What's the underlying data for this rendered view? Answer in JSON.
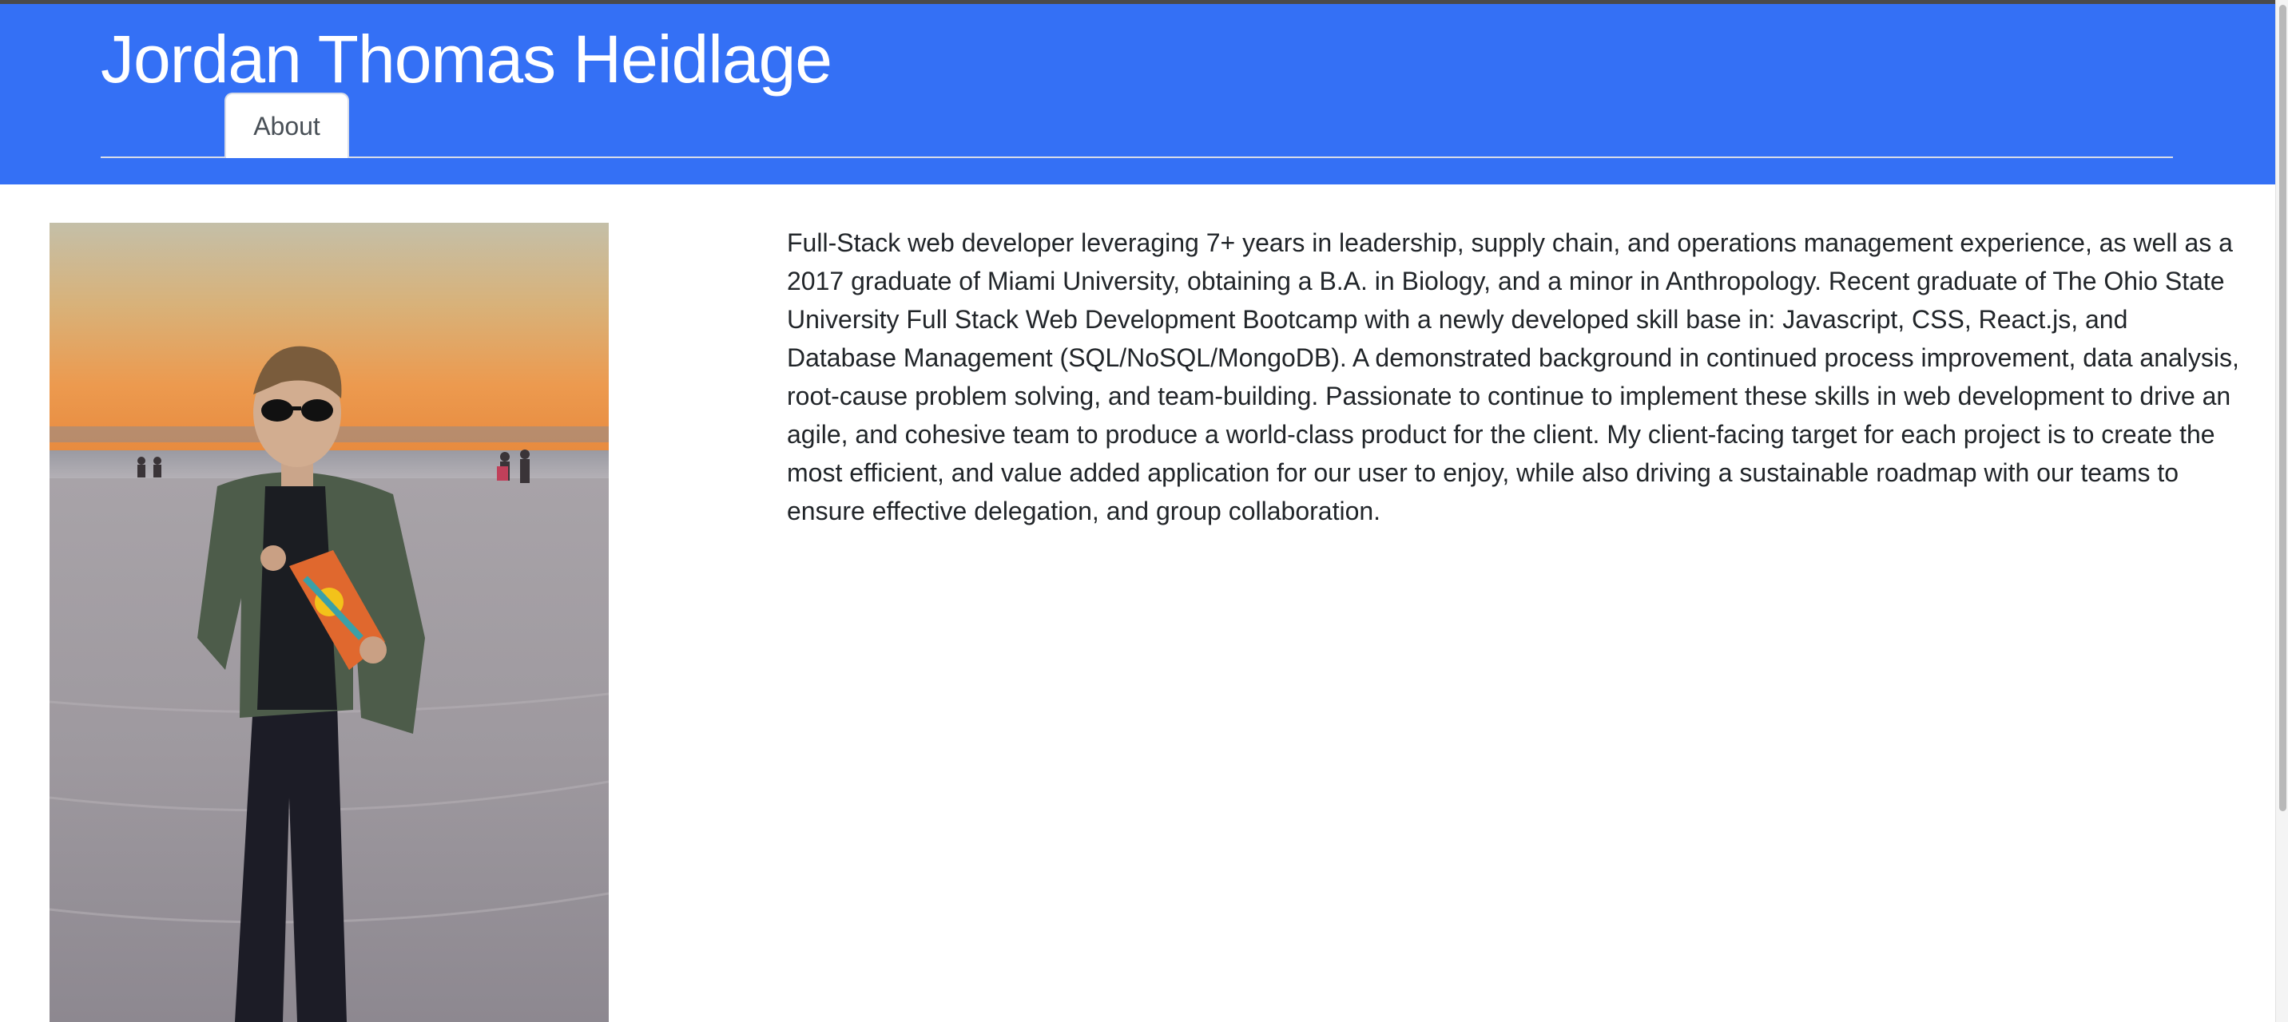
{
  "header": {
    "site_title": "Jordan Thomas Heidlage",
    "nav_tabs": [
      {
        "label": "About",
        "active": true
      }
    ]
  },
  "main": {
    "photo_alt": "Photo of Jordan Thomas Heidlage standing on a beach at sunset",
    "bio": "Full-Stack web developer leveraging 7+ years in leadership, supply chain, and operations management experience, as well as a 2017 graduate of Miami University, obtaining a B.A. in Biology, and a minor in Anthropology. Recent graduate of The Ohio State University Full Stack Web Development Bootcamp with a newly developed skill base in: Javascript, CSS, React.js, and Database Management (SQL/NoSQL/MongoDB). A demonstrated background in continued process improvement, data analysis, root-cause problem solving, and team-building. Passionate to continue to implement these skills in web development to drive an agile, and cohesive team to produce a world-class product for the client. My client-facing target for each project is to create the most efficient, and value added application for our user to enjoy, while also driving a sustainable roadmap with our teams to ensure effective delegation, and group collaboration."
  },
  "colors": {
    "header_bg": "#3470f5",
    "title_text": "#ffffff",
    "body_text": "#212529"
  }
}
